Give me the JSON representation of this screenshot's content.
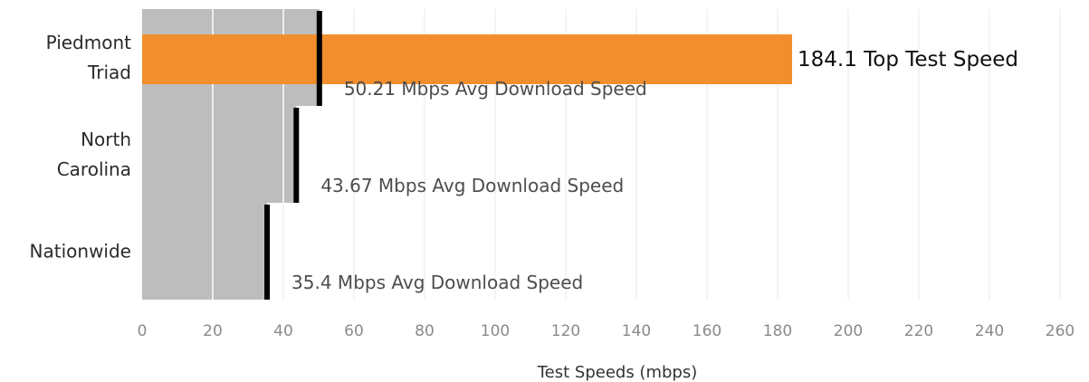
{
  "chart_data": {
    "type": "bar",
    "xlabel": "Test Speeds (mbps)",
    "xlim": [
      0,
      270
    ],
    "x_ticks": [
      0,
      20,
      40,
      60,
      80,
      100,
      120,
      140,
      160,
      180,
      200,
      220,
      240,
      260
    ],
    "grid": true,
    "categories": [
      {
        "lines": [
          "Piedmont",
          "Triad"
        ],
        "avg": 50.21,
        "avg_label": "50.21 Mbps Avg Download Speed",
        "top": 184.1,
        "top_label": "184.1 Top Test Speed"
      },
      {
        "lines": [
          "North",
          "Carolina"
        ],
        "avg": 43.67,
        "avg_label": "43.67 Mbps Avg Download Speed"
      },
      {
        "lines": [
          "Nationwide"
        ],
        "avg": 35.4,
        "avg_label": "35.4 Mbps Avg Download Speed"
      }
    ],
    "colors": {
      "band": "#bdbdbd",
      "top_bar": "#f28e2b",
      "avg_marker": "#000000",
      "grid": "#e8e8e8"
    }
  }
}
